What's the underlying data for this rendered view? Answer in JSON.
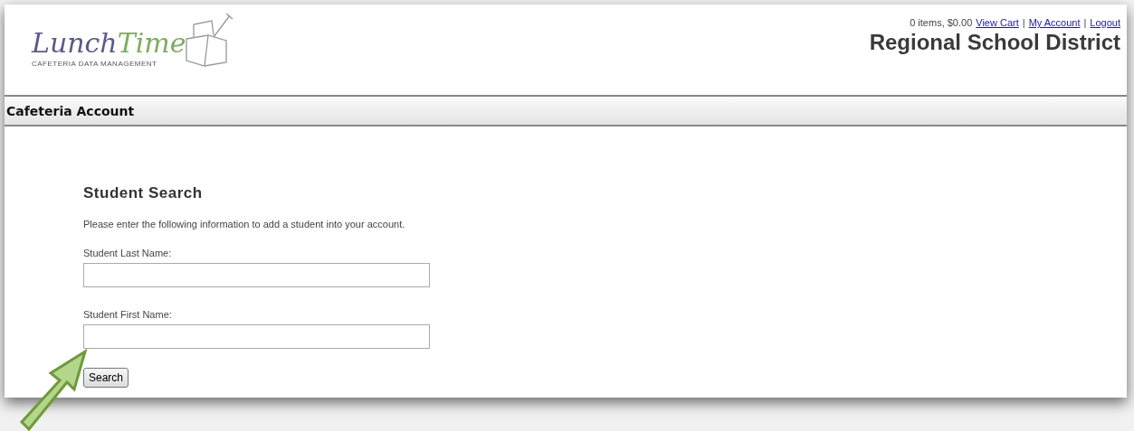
{
  "logo": {
    "name_first": "Lunch",
    "name_second": "Time",
    "tagline": "CAFETERIA DATA MANAGEMENT"
  },
  "header": {
    "cart_summary": "0 items, $0.00",
    "links": [
      "View Cart",
      "My Account",
      "Logout"
    ],
    "separator": "|",
    "district": "Regional School District"
  },
  "section_bar": {
    "title": "Cafeteria Account"
  },
  "form": {
    "title": "Student Search",
    "intro": "Please enter the following information to add a student into your account.",
    "fields": [
      {
        "label": "Student Last Name:"
      },
      {
        "label": "Student First Name:"
      }
    ],
    "button": "Search"
  }
}
